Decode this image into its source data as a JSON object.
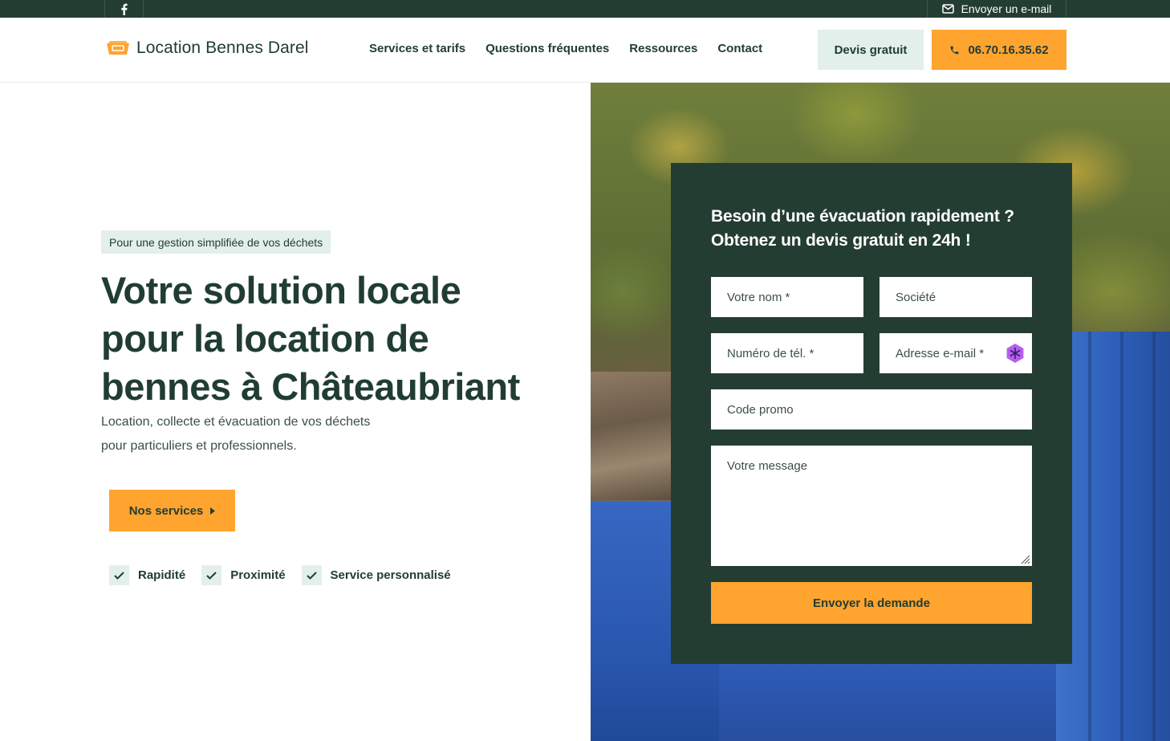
{
  "topbar": {
    "facebook_icon": "facebook-icon",
    "email_icon": "envelope-icon",
    "email_label": "Envoyer un e-mail"
  },
  "header": {
    "brand": "Location Bennes Darel",
    "logo_icon": "dumpster-icon",
    "nav": [
      {
        "label": "Services et tarifs"
      },
      {
        "label": "Questions fréquentes"
      },
      {
        "label": "Ressources"
      },
      {
        "label": "Contact"
      }
    ],
    "quote_button": "Devis gratuit",
    "phone_icon": "phone-icon",
    "phone": "06.70.16.35.62"
  },
  "hero": {
    "tagline": "Pour une gestion simplifiée de vos déchets",
    "title": "Votre solution locale pour la location de bennes à Châteaubriant",
    "subtitle": "Location, collecte et évacuation de vos déchets pour particuliers et professionnels.",
    "cta": "Nos services",
    "features": [
      {
        "label": "Rapidité"
      },
      {
        "label": "Proximité"
      },
      {
        "label": "Service personnalisé"
      }
    ]
  },
  "form": {
    "title": "Besoin d’une évacuation rapidement ? Obtenez un devis gratuit en 24h !",
    "name_placeholder": "Votre nom *",
    "company_placeholder": "Société",
    "phone_placeholder": "Numéro de tél. *",
    "email_placeholder": "Adresse e-mail *",
    "promo_placeholder": "Code promo",
    "message_placeholder": "Votre message",
    "submit": "Envoyer la demande"
  },
  "colors": {
    "dark_green": "#243d33",
    "orange": "#fea42f",
    "mint": "#e3efea"
  }
}
